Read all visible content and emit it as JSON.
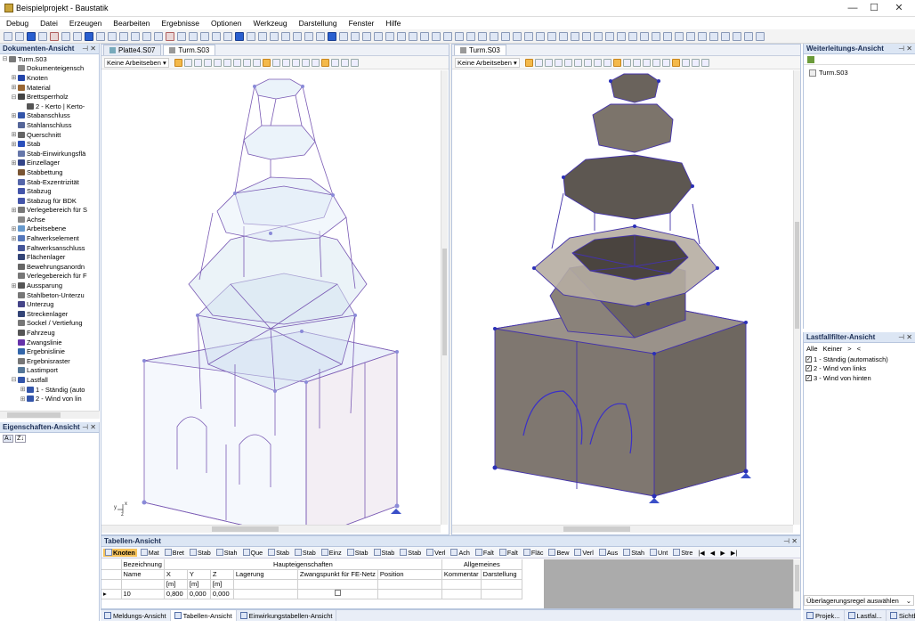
{
  "window": {
    "title": "Beispielprojekt - Baustatik",
    "controls": [
      "—",
      "☐",
      "✕"
    ]
  },
  "menu": [
    "Debug",
    "Datei",
    "Erzeugen",
    "Bearbeiten",
    "Ergebnisse",
    "Optionen",
    "Werkzeug",
    "Darstellung",
    "Fenster",
    "Hilfe"
  ],
  "doc_view": {
    "title": "Dokumenten-Ansicht",
    "pin": "⊣ ✕",
    "items": [
      {
        "label": "Turm.S03",
        "level": 0,
        "exp": "⊟",
        "color": "#7a7a7a"
      },
      {
        "label": "Dokumenteigensch",
        "level": 1,
        "exp": "",
        "color": "#888888"
      },
      {
        "label": "Knoten",
        "level": 1,
        "exp": "⊞",
        "color": "#2244aa"
      },
      {
        "label": "Material",
        "level": 1,
        "exp": "⊞",
        "color": "#996633"
      },
      {
        "label": "Brettsperrholz",
        "level": 1,
        "exp": "⊟",
        "color": "#444444"
      },
      {
        "label": "2 - Kerto | Kerto-",
        "level": 2,
        "exp": "",
        "color": "#555555"
      },
      {
        "label": "Stabanschluss",
        "level": 1,
        "exp": "⊞",
        "color": "#3355aa"
      },
      {
        "label": "Stahlanschluss",
        "level": 1,
        "exp": "",
        "color": "#556699"
      },
      {
        "label": "Querschnitt",
        "level": 1,
        "exp": "⊞",
        "color": "#666666"
      },
      {
        "label": "Stab",
        "level": 1,
        "exp": "⊞",
        "color": "#2a4fbb"
      },
      {
        "label": "Stab-Einwirkungsflä",
        "level": 1,
        "exp": "",
        "color": "#6677aa"
      },
      {
        "label": "Einzellager",
        "level": 1,
        "exp": "⊞",
        "color": "#334488"
      },
      {
        "label": "Stabbettung",
        "level": 1,
        "exp": "",
        "color": "#7a5533"
      },
      {
        "label": "Stab-Exzentrizität",
        "level": 1,
        "exp": "",
        "color": "#5566aa"
      },
      {
        "label": "Stabzug",
        "level": 1,
        "exp": "",
        "color": "#4455aa"
      },
      {
        "label": "Stabzug für BDK",
        "level": 1,
        "exp": "",
        "color": "#4455aa"
      },
      {
        "label": "Verlegebereich für S",
        "level": 1,
        "exp": "⊞",
        "color": "#777777"
      },
      {
        "label": "Achse",
        "level": 1,
        "exp": "",
        "color": "#888888"
      },
      {
        "label": "Arbeitsebene",
        "level": 1,
        "exp": "⊞",
        "color": "#6699cc"
      },
      {
        "label": "Faltwerkselement",
        "level": 1,
        "exp": "⊞",
        "color": "#5577bb"
      },
      {
        "label": "Faltwerksanschluss",
        "level": 1,
        "exp": "",
        "color": "#445599"
      },
      {
        "label": "Flächenlager",
        "level": 1,
        "exp": "",
        "color": "#334477"
      },
      {
        "label": "Bewehrungsanordn",
        "level": 1,
        "exp": "",
        "color": "#666666"
      },
      {
        "label": "Verlegebereich für F",
        "level": 1,
        "exp": "",
        "color": "#777777"
      },
      {
        "label": "Aussparung",
        "level": 1,
        "exp": "⊞",
        "color": "#555555"
      },
      {
        "label": "Stahlbeton-Unterzu",
        "level": 1,
        "exp": "",
        "color": "#777777"
      },
      {
        "label": "Unterzug",
        "level": 1,
        "exp": "",
        "color": "#444488"
      },
      {
        "label": "Streckenlager",
        "level": 1,
        "exp": "",
        "color": "#334477"
      },
      {
        "label": "Sockel / Vertiefung",
        "level": 1,
        "exp": "",
        "color": "#777777"
      },
      {
        "label": "Fahrzeug",
        "level": 1,
        "exp": "",
        "color": "#555555"
      },
      {
        "label": "Zwangslinie",
        "level": 1,
        "exp": "",
        "color": "#6633aa"
      },
      {
        "label": "Ergebnislinie",
        "level": 1,
        "exp": "",
        "color": "#3366aa"
      },
      {
        "label": "Ergebnisraster",
        "level": 1,
        "exp": "",
        "color": "#777777"
      },
      {
        "label": "Lastimport",
        "level": 1,
        "exp": "",
        "color": "#557799"
      },
      {
        "label": "Lastfall",
        "level": 1,
        "exp": "⊟",
        "color": "#3355aa"
      },
      {
        "label": "1 - Ständig (auto",
        "level": 2,
        "exp": "⊞",
        "color": "#3355aa"
      },
      {
        "label": "2 - Wind von lin",
        "level": 2,
        "exp": "⊞",
        "color": "#3355aa"
      }
    ]
  },
  "props_view": {
    "title": "Eigenschaften-Ansicht",
    "pin": "⊣ ✕",
    "sort_labels": [
      "A↓",
      "Z↓"
    ]
  },
  "tabs": {
    "left": [
      {
        "label": "Platte4.S07"
      },
      {
        "label": "Turm.S03"
      }
    ],
    "right": [
      {
        "label": "Turm.S03"
      }
    ],
    "work_plane": "Keine Arbeitseben ▾"
  },
  "viewport_left": {
    "axis_labels": [
      "y",
      "x",
      "z"
    ]
  },
  "forward_view": {
    "title": "Weiterleitungs-Ansicht",
    "pin": "⊣ ✕",
    "item": "Turm.S03"
  },
  "loadcase_filter": {
    "title": "Lastfallfilter-Ansicht",
    "pin": "⊣ ✕",
    "controls": [
      "Alle",
      "Keiner",
      ">",
      "<"
    ],
    "items": [
      {
        "label": "1 - Ständig (automatisch)",
        "checked": true
      },
      {
        "label": "2 - Wind von links",
        "checked": true
      },
      {
        "label": "3 - Wind von hinten",
        "checked": true
      }
    ],
    "overlay_select": "Überlagerungsregel auswählen"
  },
  "table_view": {
    "title": "Tabellen-Ansicht",
    "pin": "⊣ ✕",
    "tabs": [
      "Knoten",
      "Mat",
      "Bret",
      "Stab",
      "Stah",
      "Que",
      "Stab",
      "Stab",
      "Einz",
      "Stab",
      "Stab",
      "Stab",
      "Verl",
      "Ach",
      "Falt",
      "Falt",
      "Fläc",
      "Bew",
      "Verl",
      "Aus",
      "Stah",
      "Unt",
      "Stre"
    ],
    "nav": [
      "|◀",
      "◀",
      "▶",
      "▶|"
    ],
    "group_headers": [
      "Bezeichnung",
      "Haupteigenschaften",
      "Allgemeines"
    ],
    "columns": [
      "Name",
      "X",
      "Y",
      "Z",
      "Lagerung",
      "Zwangspunkt für FE-Netz",
      "Position",
      "Kommentar",
      "Darstellung"
    ],
    "units": [
      "",
      "[m]",
      "[m]",
      "[m]",
      "",
      "",
      "",
      "",
      ""
    ],
    "rows": [
      {
        "marker": "▸",
        "name": "10",
        "x": "0,800",
        "y": "0,000",
        "z": "0,000"
      }
    ]
  },
  "bottom_tabs": [
    "Meldungs-Ansicht",
    "Tabellen-Ansicht",
    "Einwirkungstabellen-Ansicht"
  ],
  "right_bottom_tabs": [
    "Projek...",
    "Lastfal...",
    "Sichtb..."
  ]
}
